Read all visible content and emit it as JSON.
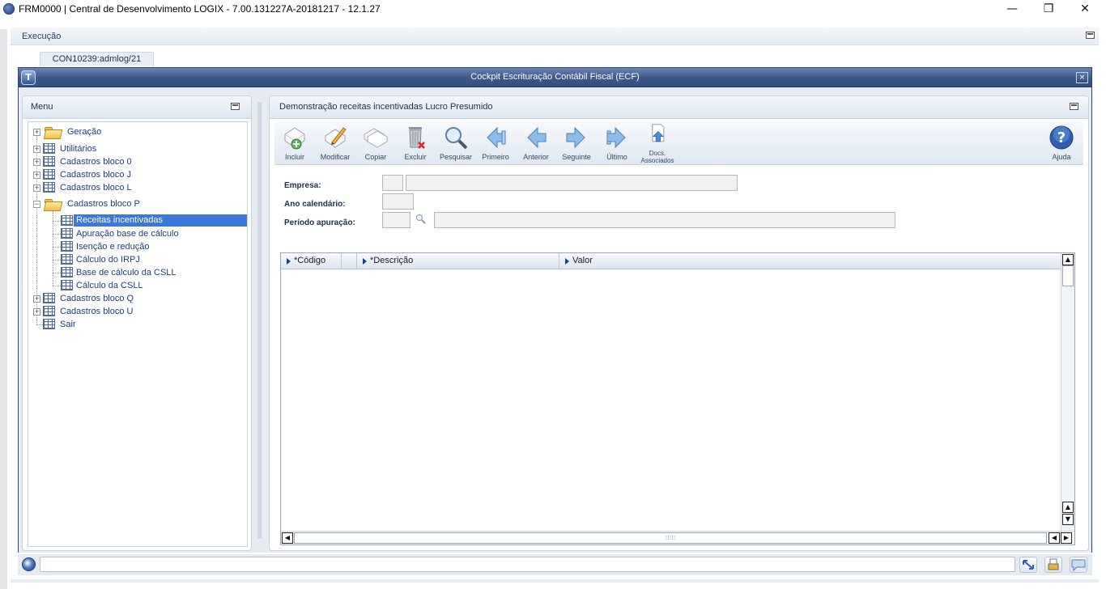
{
  "window": {
    "title": "FRM0000 | Central de Desenvolvimento LOGIX  -  7.00.131227A-20181217  -  12.1.27",
    "minimize": "—",
    "maximize": "❐",
    "close": "✕"
  },
  "exec_bar": {
    "label": "Execução"
  },
  "tabs": [
    {
      "label": "CON10239:admlog/21",
      "active": true
    }
  ],
  "cockpit": {
    "title": "Cockpit Escrituração Contábil Fiscal (ECF)",
    "close": "×"
  },
  "menu": {
    "title": "Menu",
    "items": [
      {
        "label": "Geração",
        "icon": "folder-icon",
        "expanded": false
      },
      {
        "label": "Utilitários",
        "icon": "grid-icon"
      },
      {
        "label": "Cadastros bloco 0",
        "icon": "grid-icon"
      },
      {
        "label": "Cadastros bloco J",
        "icon": "grid-icon"
      },
      {
        "label": "Cadastros bloco L",
        "icon": "grid-icon"
      },
      {
        "label": "Cadastros bloco P",
        "icon": "folder-icon",
        "expanded": true,
        "children": [
          {
            "label": "Receitas incentivadas",
            "selected": true
          },
          {
            "label": "Apuração base de cálculo"
          },
          {
            "label": "Isenção e redução"
          },
          {
            "label": "Cálculo do IRPJ"
          },
          {
            "label": "Base de cálculo da CSLL"
          },
          {
            "label": "Cálculo da CSLL"
          }
        ]
      },
      {
        "label": "Cadastros bloco Q",
        "icon": "grid-icon"
      },
      {
        "label": "Cadastros bloco U",
        "icon": "grid-icon"
      },
      {
        "label": "Sair",
        "icon": "grid-icon"
      }
    ]
  },
  "content": {
    "title": "Demonstração receitas incentivadas Lucro Presumido",
    "toolbar": [
      {
        "label": "Incluir",
        "icon": "add-icon"
      },
      {
        "label": "Modificar",
        "icon": "edit-icon"
      },
      {
        "label": "Copiar",
        "icon": "copy-icon"
      },
      {
        "label": "Excluir",
        "icon": "trash-icon"
      },
      {
        "label": "Pesquisar",
        "icon": "search-icon"
      },
      {
        "label": "Primeiro",
        "icon": "first-icon"
      },
      {
        "label": "Anterior",
        "icon": "previous-icon"
      },
      {
        "label": "Seguinte",
        "icon": "next-icon"
      },
      {
        "label": "Último",
        "icon": "last-icon"
      },
      {
        "label": "Docs.\nAssociados",
        "icon": "documents-icon"
      }
    ],
    "help": {
      "label": "Ajuda",
      "icon": "help-icon"
    },
    "form": {
      "empresa": {
        "label": "Empresa:",
        "code": "",
        "name": ""
      },
      "ano": {
        "label": "Ano calendário:",
        "value": ""
      },
      "periodo": {
        "label": "Período apuração:",
        "code": "",
        "name": ""
      }
    },
    "grid": {
      "columns": [
        "*Código",
        "*Descrição",
        "Valor"
      ],
      "rows": []
    }
  },
  "status": {
    "message": ""
  },
  "colors": {
    "header": "#3c5689",
    "selection": "#3b78d8",
    "link": "#1d3e7c"
  }
}
